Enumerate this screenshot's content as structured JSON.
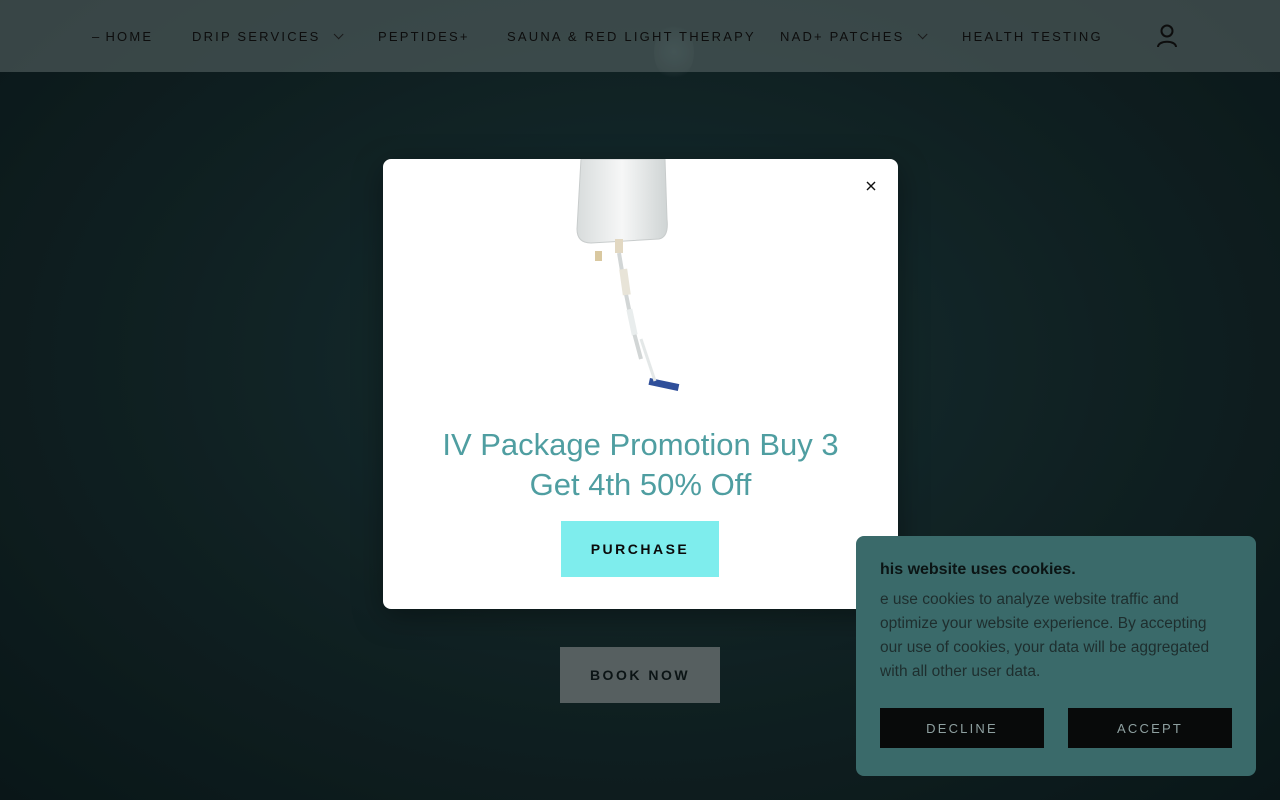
{
  "nav": {
    "items": [
      {
        "label": "HOME",
        "has_dropdown": false
      },
      {
        "label": "DRIP SERVICES",
        "has_dropdown": true
      },
      {
        "label": "PEPTIDES+",
        "has_dropdown": false
      },
      {
        "label": "SAUNA & RED LIGHT THERAPY",
        "has_dropdown": false
      },
      {
        "label": "NAD+ PATCHES",
        "has_dropdown": true
      },
      {
        "label": "HEALTH TESTING",
        "has_dropdown": false
      }
    ],
    "account_icon": "user-icon"
  },
  "hero": {
    "cta_label": "BOOK NOW"
  },
  "popup": {
    "title": "IV Package Promotion Buy 3 Get 4th 50% Off",
    "button_label": "PURCHASE",
    "close_icon": "close-icon",
    "title_color": "#4f9ea1",
    "button_color": "#7eeded"
  },
  "cookie_banner": {
    "title": "his website uses cookies.",
    "body": "e use cookies to analyze website traffic and optimize your website experience. By accepting our use of cookies, your data will be aggregated with all other user data.",
    "decline_label": "DECLINE",
    "accept_label": "ACCEPT",
    "background_color": "#3a6a6a"
  }
}
